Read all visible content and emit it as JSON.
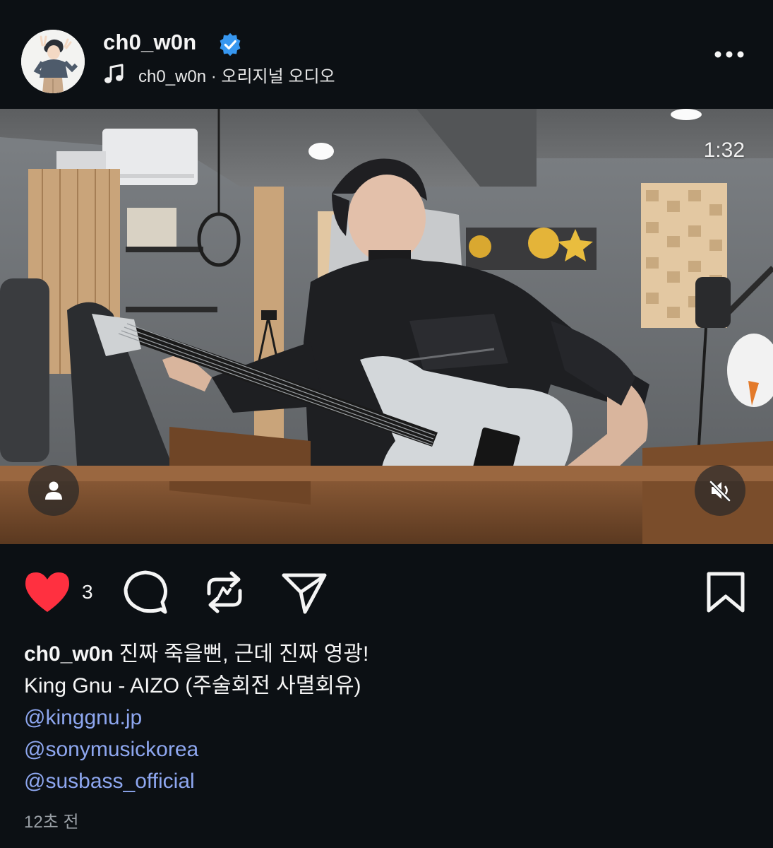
{
  "post": {
    "username": "ch0_w0n",
    "verified": true,
    "audio": {
      "icon": "music-note-icon",
      "text": "ch0_w0n · 오리지널 오디오"
    },
    "more_icon": "more-horizontal-icon"
  },
  "media": {
    "type": "video",
    "timestamp": "1:32",
    "tag_icon": "user-tag-icon",
    "mute_icon": "speaker-muted-icon"
  },
  "actions": {
    "like_icon": "heart-filled-icon",
    "like_count": "3",
    "comment_icon": "comment-icon",
    "repost_icon": "repost-icon",
    "share_icon": "send-icon",
    "save_icon": "bookmark-icon"
  },
  "caption": {
    "username": "ch0_w0n",
    "text": "진짜 죽을뻔, 근데 진짜 영광!",
    "line2": "King Gnu - AIZO (주술회전 사멸회유)",
    "mentions": [
      "@kinggnu.jp",
      "@sonymusickorea",
      "@susbass_official"
    ]
  },
  "time_ago": "12초 전",
  "colors": {
    "background": "#0c1014",
    "like_red": "#ff3040",
    "mention_blue": "#8ea7f0",
    "verified_blue": "#3797f0",
    "muted_text": "#9aa0a6"
  }
}
